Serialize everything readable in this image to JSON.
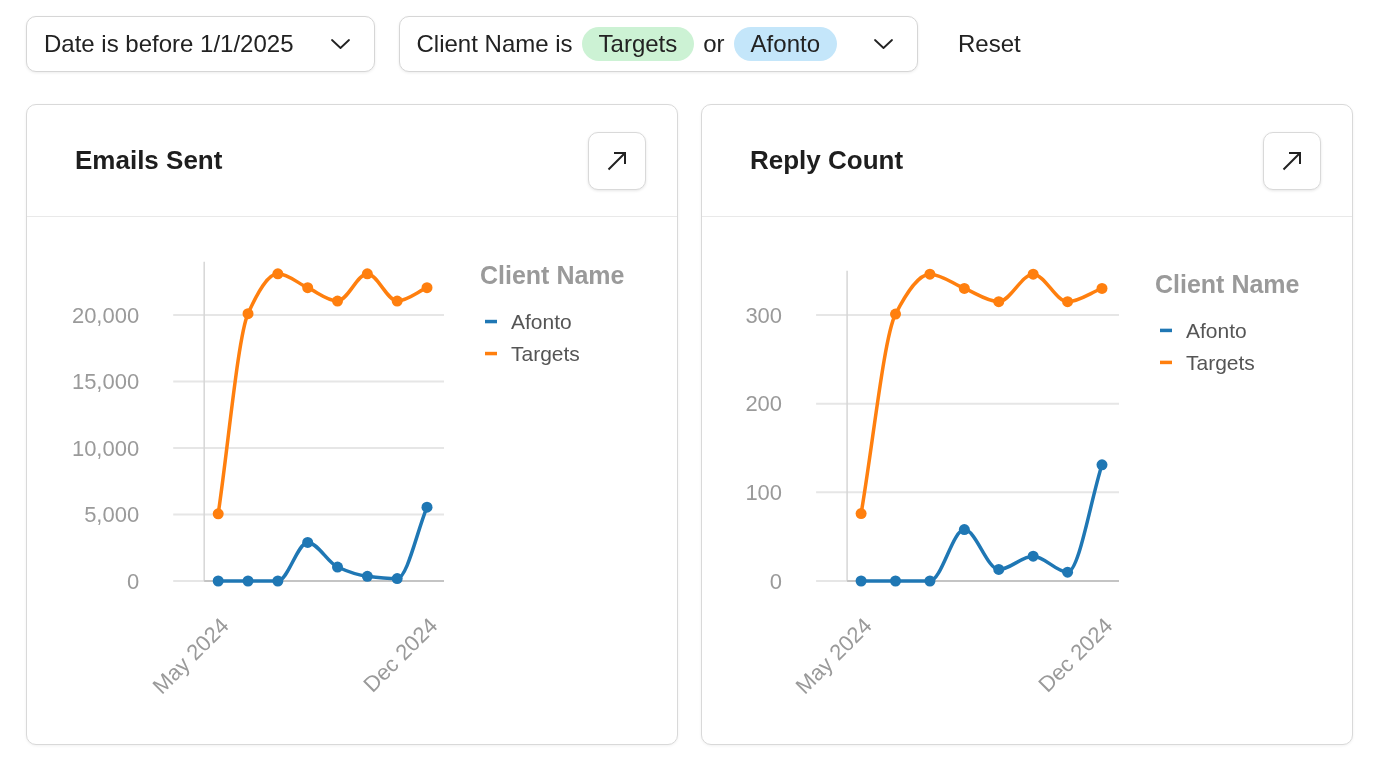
{
  "filters": [
    {
      "kind": "text",
      "label": "Date is before 1/1/2025"
    },
    {
      "kind": "values",
      "label": "Client Name is",
      "joiner": "or",
      "values": [
        {
          "text": "Targets",
          "color": "#ccf2d4"
        },
        {
          "text": "Afonto",
          "color": "#c4e6fa"
        }
      ]
    }
  ],
  "reset_button": "Reset",
  "cards": [
    {
      "title": "Emails Sent",
      "chart_data": {
        "type": "line",
        "categories": [
          "May 2024",
          null,
          null,
          null,
          null,
          null,
          null,
          "Dec 2024"
        ],
        "ylim": [
          0,
          24000
        ],
        "yticks": [
          0,
          {
            "value": 5000,
            "label": "5,000"
          },
          {
            "value": 10000,
            "label": "10,000"
          },
          {
            "value": 15000,
            "label": "15,000"
          },
          {
            "value": 20000,
            "label": "20,000"
          }
        ],
        "grid": true,
        "legend": "right",
        "legend_title": "Client Name",
        "series": [
          {
            "name": "Afonto",
            "color": "#1f77b4",
            "marker": "circle",
            "values": [
              0,
              0,
              0,
              2900,
              1050,
              350,
              180,
              5550
            ]
          },
          {
            "name": "Targets",
            "color": "#ff7f0e",
            "marker": "circle",
            "values": [
              5050,
              20100,
              23100,
              22050,
              21050,
              23100,
              21050,
              22050
            ]
          }
        ]
      }
    },
    {
      "title": "Reply Count",
      "chart_data": {
        "type": "line",
        "categories": [
          "May 2024",
          null,
          null,
          null,
          null,
          null,
          null,
          "Dec 2024"
        ],
        "ylim": [
          0,
          350
        ],
        "yticks": [
          0,
          100,
          200,
          300
        ],
        "grid": true,
        "legend": "right",
        "legend_title": "Client Name",
        "series": [
          {
            "name": "Afonto",
            "color": "#1f77b4",
            "marker": "circle",
            "values": [
              0,
              0,
              0,
              58,
              13,
              28,
              10,
              131
            ]
          },
          {
            "name": "Targets",
            "color": "#ff7f0e",
            "marker": "circle",
            "values": [
              76,
              301,
              346,
              330,
              315,
              346,
              315,
              330
            ]
          }
        ]
      }
    }
  ]
}
